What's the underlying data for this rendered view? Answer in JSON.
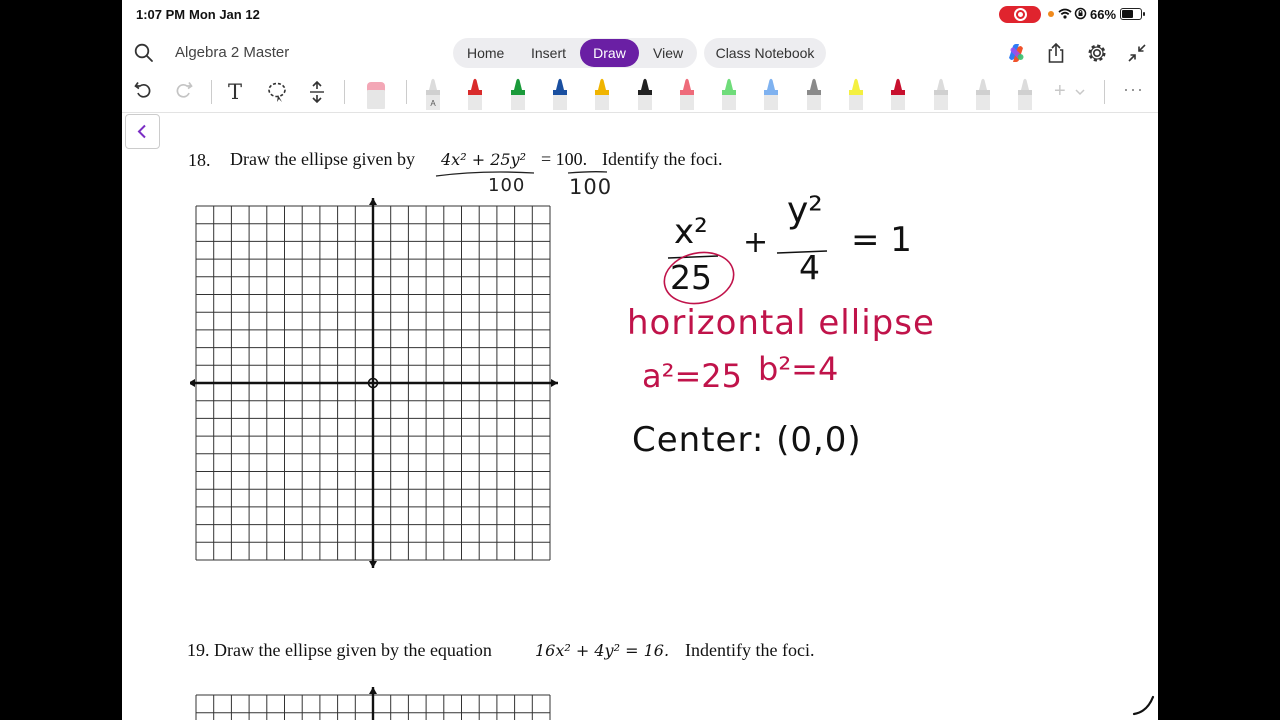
{
  "status_bar": {
    "time": "1:07 PM",
    "date": "Mon Jan 12",
    "battery_text": "66%",
    "battery_level": 0.66
  },
  "header": {
    "notebook_title": "Algebra 2 Master",
    "tabs": [
      {
        "label": "Home"
      },
      {
        "label": "Insert"
      },
      {
        "label": "Draw",
        "active": true
      },
      {
        "label": "View"
      }
    ],
    "class_notebook_label": "Class Notebook"
  },
  "toolbar": {
    "text_tool_glyph": "T",
    "pens": [
      {
        "color": "#ffffff",
        "label": "A"
      },
      {
        "color": "#d92b2b"
      },
      {
        "color": "#1a9a3a"
      },
      {
        "color": "#1a4fa0"
      },
      {
        "color": "#f0b400"
      },
      {
        "color": "#222222"
      },
      {
        "color": "#ee6b7a"
      },
      {
        "color": "#6fdc7a"
      },
      {
        "color": "#7fb2f0"
      },
      {
        "color": "#8a8a8a"
      },
      {
        "color": "#f4f040"
      },
      {
        "color": "#c8102e"
      },
      {
        "color": "#ffffff"
      },
      {
        "color": "#ffffff"
      },
      {
        "color": "#ffffff"
      }
    ]
  },
  "page": {
    "q18": {
      "number": "18.",
      "prefix": "Draw the ellipse given by",
      "eq_lhs": "4x² + 25y²",
      "eq_rhs": "= 100.",
      "suffix": "Identify the foci."
    },
    "q19": {
      "text_before": "19. Draw the ellipse given by the equation",
      "equation": "16x² + 4y² = 16.",
      "text_after": "Indentify the foci."
    },
    "handwriting": {
      "under_lhs": "100",
      "under_rhs": "100",
      "x_sq": "x²",
      "a_denominator": "25",
      "plus": "+",
      "y_sq": "y²",
      "b_denominator": "4",
      "equals_one": "= 1",
      "type_label": "horizontal ellipse",
      "a_sq_value": "a²=25",
      "b_sq_value": "b²=4",
      "center_label": "Center: (0,0)"
    },
    "handwriting_color": "#c0134a"
  }
}
